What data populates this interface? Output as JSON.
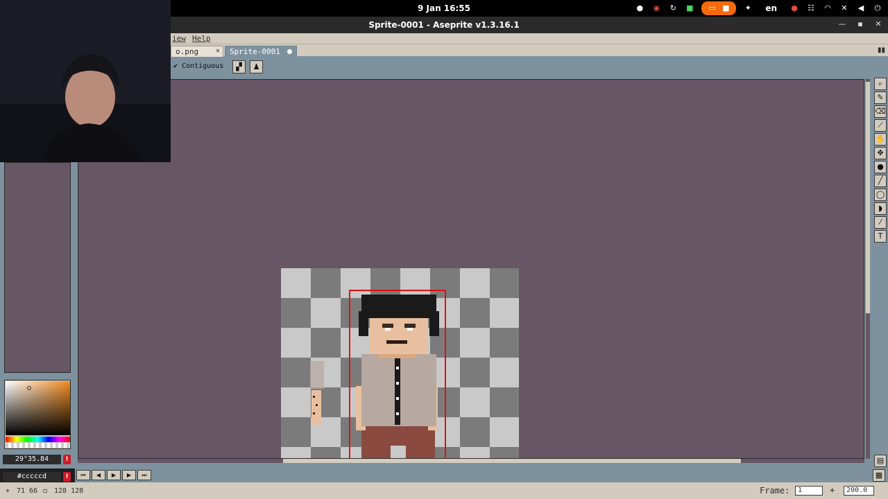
{
  "system": {
    "clock": "9 Jan  16:55",
    "language": "en",
    "tray_icons": [
      "discord-icon",
      "chrome-icon",
      "steam-icon",
      "lock-icon",
      "screen-share-icon",
      "accessibility-icon",
      "microphone-icon",
      "network-icon",
      "wifi-icon",
      "notifications-off-icon",
      "volume-icon",
      "power-icon"
    ]
  },
  "window": {
    "title": "Sprite-0001 - Aseprite v1.3.16.1",
    "buttons": [
      "minimize",
      "maximize",
      "close"
    ]
  },
  "menubar": {
    "items": [
      "View",
      "Help"
    ],
    "visible_items": [
      "iew",
      "Help"
    ]
  },
  "tabs": [
    {
      "label": "o.png",
      "active": false,
      "close": "✕"
    },
    {
      "label": "Sprite-0001",
      "active": true,
      "modified": true
    }
  ],
  "context_bar": {
    "contiguous_label": "Contiguous",
    "contiguous_checked": true
  },
  "color_panel": {
    "hsv_text": "29°35.84",
    "hex_text": "#cccccd",
    "warning_label": "!"
  },
  "status_bar": {
    "cursor_pos": "71 66",
    "sprite_size": "128 128",
    "frame_label": "Frame:",
    "frame_value": "1",
    "zoom_value": "200.0"
  },
  "colors": {
    "accent": "#f66a0a",
    "canvas_bg": "#675664",
    "ui_face": "#d3cbbe",
    "ui_blue": "#7d929e",
    "selection": "#e01010",
    "warning": "#d2192a"
  }
}
